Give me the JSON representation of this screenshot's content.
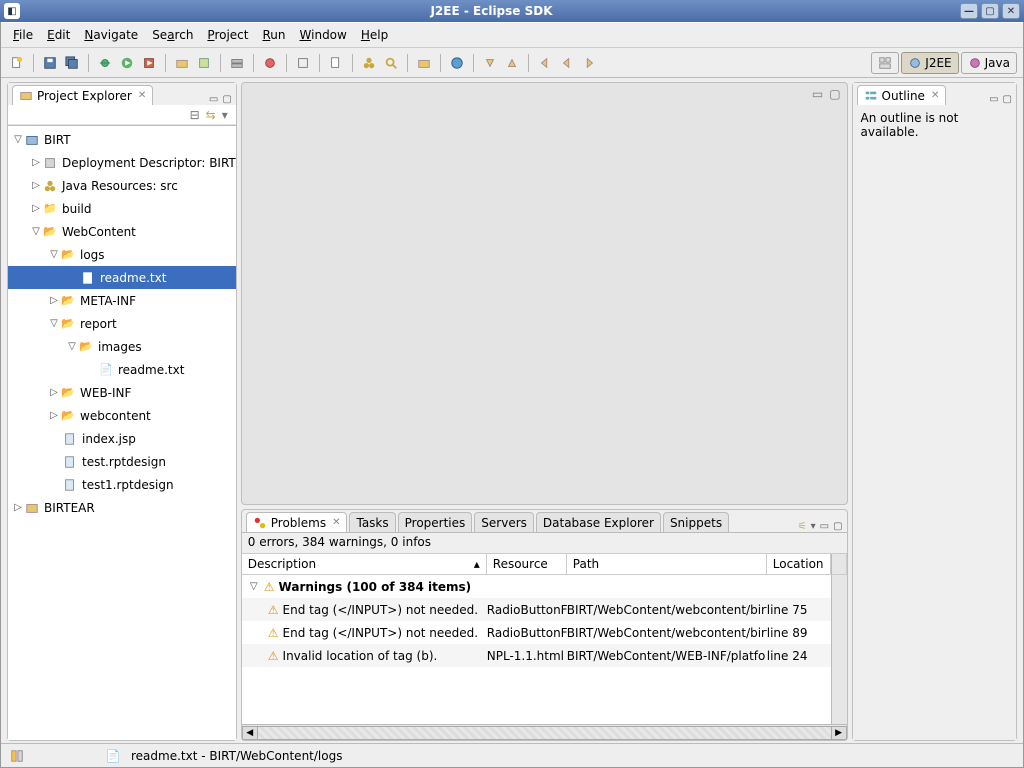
{
  "window": {
    "title": "J2EE - Eclipse SDK"
  },
  "menubar": [
    "File",
    "Edit",
    "Navigate",
    "Search",
    "Project",
    "Run",
    "Window",
    "Help"
  ],
  "perspectives": {
    "j2ee": "J2EE",
    "java": "Java"
  },
  "projectExplorer": {
    "title": "Project Explorer",
    "tree": {
      "birt": "BIRT",
      "deploy": "Deployment Descriptor: BIRT",
      "javares": "Java Resources: src",
      "build": "build",
      "webcontent": "WebContent",
      "logs": "logs",
      "readme1": "readme.txt",
      "metainf": "META-INF",
      "report": "report",
      "images": "images",
      "readme2": "readme.txt",
      "webinf": "WEB-INF",
      "webcontent2": "webcontent",
      "indexjsp": "index.jsp",
      "testrpt": "test.rptdesign",
      "testrpt1": "test1.rptdesign",
      "birtear": "BIRTEAR"
    }
  },
  "outline": {
    "title": "Outline",
    "body": "An outline is not available."
  },
  "problems": {
    "tab_problems": "Problems",
    "tab_tasks": "Tasks",
    "tab_properties": "Properties",
    "tab_servers": "Servers",
    "tab_db": "Database Explorer",
    "tab_snippets": "Snippets",
    "status": "0 errors, 384 warnings, 0 infos",
    "col_desc": "Description",
    "col_res": "Resource",
    "col_path": "Path",
    "col_loc": "Location",
    "group": "Warnings (100 of 384 items)",
    "rows": [
      {
        "desc": "End tag (</INPUT>) not needed.",
        "res": "RadioButtonF",
        "path": "BIRT/WebContent/webcontent/birt",
        "loc": "line 75"
      },
      {
        "desc": "End tag (</INPUT>) not needed.",
        "res": "RadioButtonF",
        "path": "BIRT/WebContent/webcontent/birt",
        "loc": "line 89"
      },
      {
        "desc": "Invalid location of tag (b).",
        "res": "NPL-1.1.html",
        "path": "BIRT/WebContent/WEB-INF/platfo",
        "loc": "line 24"
      }
    ]
  },
  "statusbar": {
    "path": "readme.txt - BIRT/WebContent/logs"
  }
}
